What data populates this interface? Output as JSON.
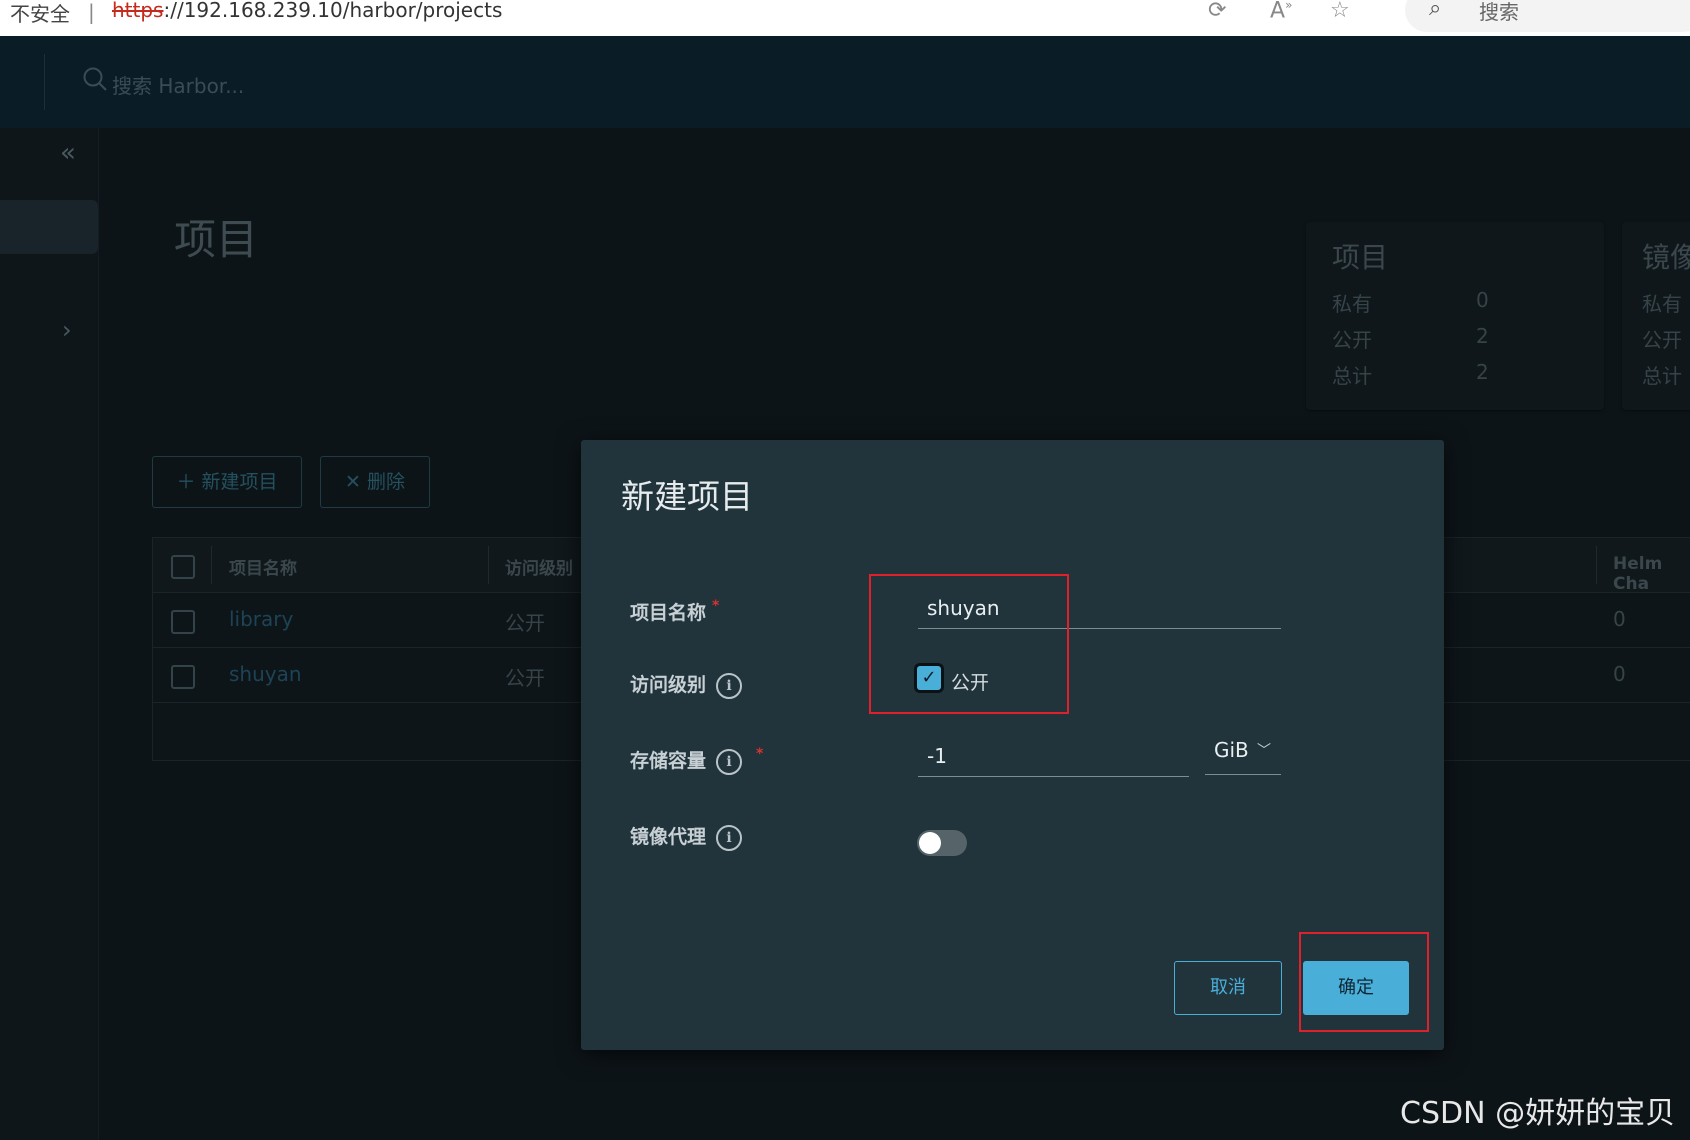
{
  "browser": {
    "security_label": "不安全",
    "url_scheme": "https",
    "url_rest": "://192.168.239.10/harbor/projects",
    "search_label": "搜索"
  },
  "header": {
    "search_placeholder": "搜索 Harbor..."
  },
  "page": {
    "title": "项目"
  },
  "summary_cards": [
    {
      "title": "项目",
      "rows": [
        {
          "label": "私有",
          "value": "0"
        },
        {
          "label": "公开",
          "value": "2"
        },
        {
          "label": "总计",
          "value": "2"
        }
      ]
    },
    {
      "title": "镜像",
      "rows": [
        {
          "label": "私有"
        },
        {
          "label": "公开"
        },
        {
          "label": "总计"
        }
      ]
    }
  ],
  "toolbar": {
    "new_project": "新建项目",
    "delete": "删除"
  },
  "table": {
    "columns": [
      "项目名称",
      "访问级别",
      "Helm Cha"
    ],
    "rows": [
      {
        "name": "library",
        "access": "公开",
        "helm": "0"
      },
      {
        "name": "shuyan",
        "access": "公开",
        "helm": "0"
      }
    ]
  },
  "modal": {
    "title": "新建项目",
    "fields": {
      "project_name": {
        "label": "项目名称",
        "value": "shuyan"
      },
      "access_level": {
        "label": "访问级别",
        "checkbox_label": "公开",
        "checked": true
      },
      "storage_quota": {
        "label": "存储容量",
        "value": "-1",
        "unit": "GiB"
      },
      "proxy_cache": {
        "label": "镜像代理",
        "enabled": false
      }
    },
    "cancel_label": "取消",
    "confirm_label": "确定"
  },
  "colors": {
    "accent": "#49afd9",
    "modal_bg": "#21333b",
    "annotation": "#e0202a"
  },
  "watermark": "CSDN @妍妍的宝贝"
}
